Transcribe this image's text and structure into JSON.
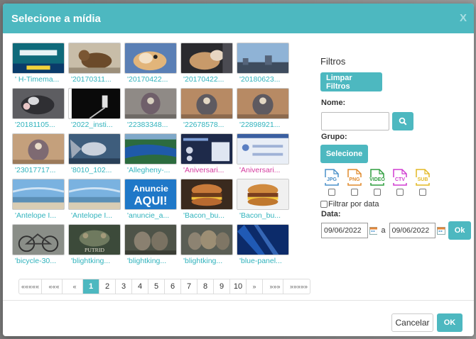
{
  "dialog": {
    "title": "Selecione a mídia",
    "close_label": "X"
  },
  "media": [
    {
      "caption": "' H-Timema...",
      "color": "cyan",
      "thumb": "teal-banner"
    },
    {
      "caption": "'20170311...",
      "color": "cyan",
      "thumb": "cat-brown"
    },
    {
      "caption": "'20170422...",
      "color": "cyan",
      "thumb": "hamster"
    },
    {
      "caption": "'20170422...",
      "color": "cyan",
      "thumb": "hamster-dark"
    },
    {
      "caption": "'20180623...",
      "color": "cyan",
      "thumb": "city-sky"
    },
    {
      "caption": "'20181105...",
      "color": "cyan",
      "thumb": "rat"
    },
    {
      "caption": "'2022_insti...",
      "color": "cyan",
      "thumb": "dark-cable"
    },
    {
      "caption": "'22383348...",
      "color": "cyan",
      "thumb": "figure-grey"
    },
    {
      "caption": "'22678578...",
      "color": "cyan",
      "thumb": "figure-brown"
    },
    {
      "caption": "'22898921...",
      "color": "cyan",
      "thumb": "figure-brown"
    },
    {
      "caption": "'23017717...",
      "color": "cyan",
      "thumb": "figure-tan"
    },
    {
      "caption": "'8010_102...",
      "color": "cyan",
      "thumb": "betta-fish"
    },
    {
      "caption": "'Allegheny-...",
      "color": "cyan",
      "thumb": "lake-aerial"
    },
    {
      "caption": "'Aniversari...",
      "color": "pink",
      "thumb": "web-dark"
    },
    {
      "caption": "'Aniversari...",
      "color": "pink",
      "thumb": "web-light"
    },
    {
      "caption": "'Antelope I...",
      "color": "cyan",
      "thumb": "beach-sky"
    },
    {
      "caption": "'Antelope I...",
      "color": "cyan",
      "thumb": "beach-sky"
    },
    {
      "caption": "'anuncie_a...",
      "color": "cyan",
      "thumb": "anuncie-banner",
      "banner_text": [
        "Anuncie",
        "AQUI!"
      ]
    },
    {
      "caption": "'Bacon_bu...",
      "color": "cyan",
      "thumb": "burger-dark"
    },
    {
      "caption": "'Bacon_bu...",
      "color": "cyan",
      "thumb": "burger-light"
    },
    {
      "caption": "'bicycle-30...",
      "color": "cyan",
      "thumb": "bicycle"
    },
    {
      "caption": "'blightking...",
      "color": "cyan",
      "thumb": "mini-putrid",
      "banner_text": [
        "PUTRID"
      ]
    },
    {
      "caption": "'blightking...",
      "color": "cyan",
      "thumb": "mini-group"
    },
    {
      "caption": "'blightking...",
      "color": "cyan",
      "thumb": "mini-group2"
    },
    {
      "caption": "'blue-panel...",
      "color": "cyan",
      "thumb": "blue-panel"
    }
  ],
  "pagination": {
    "first": "«««««",
    "prev_block": "«««",
    "prev": "«",
    "pages": [
      "1",
      "2",
      "3",
      "4",
      "5",
      "6",
      "7",
      "8",
      "9",
      "10"
    ],
    "active": "1",
    "next": "»",
    "next_block": "»»»",
    "last": "»»»»»"
  },
  "filters": {
    "title": "Filtros",
    "clear_label": "Limpar Filtros",
    "name_label": "Nome:",
    "name_value": "",
    "group_label": "Grupo:",
    "group_button": "Selecione",
    "file_types": [
      {
        "label": "JPG",
        "color": "#4a90c8"
      },
      {
        "label": "PNG",
        "color": "#e08a2c"
      },
      {
        "label": "VIDEO",
        "color": "#2f9e3f"
      },
      {
        "label": "CTV",
        "color": "#d03bd0"
      },
      {
        "label": "SUB",
        "color": "#e2b824"
      }
    ],
    "date_filter_label": "Filtrar por data",
    "date_label": "Data:",
    "date_from": "09/06/2022",
    "date_sep": "a",
    "date_to": "09/06/2022",
    "apply_label": "Ok"
  },
  "footer": {
    "cancel_label": "Cancelar",
    "ok_label": "OK"
  },
  "colors": {
    "accent": "#4db8c0",
    "link": "#31b3bd",
    "link_alt": "#d43a9e"
  }
}
